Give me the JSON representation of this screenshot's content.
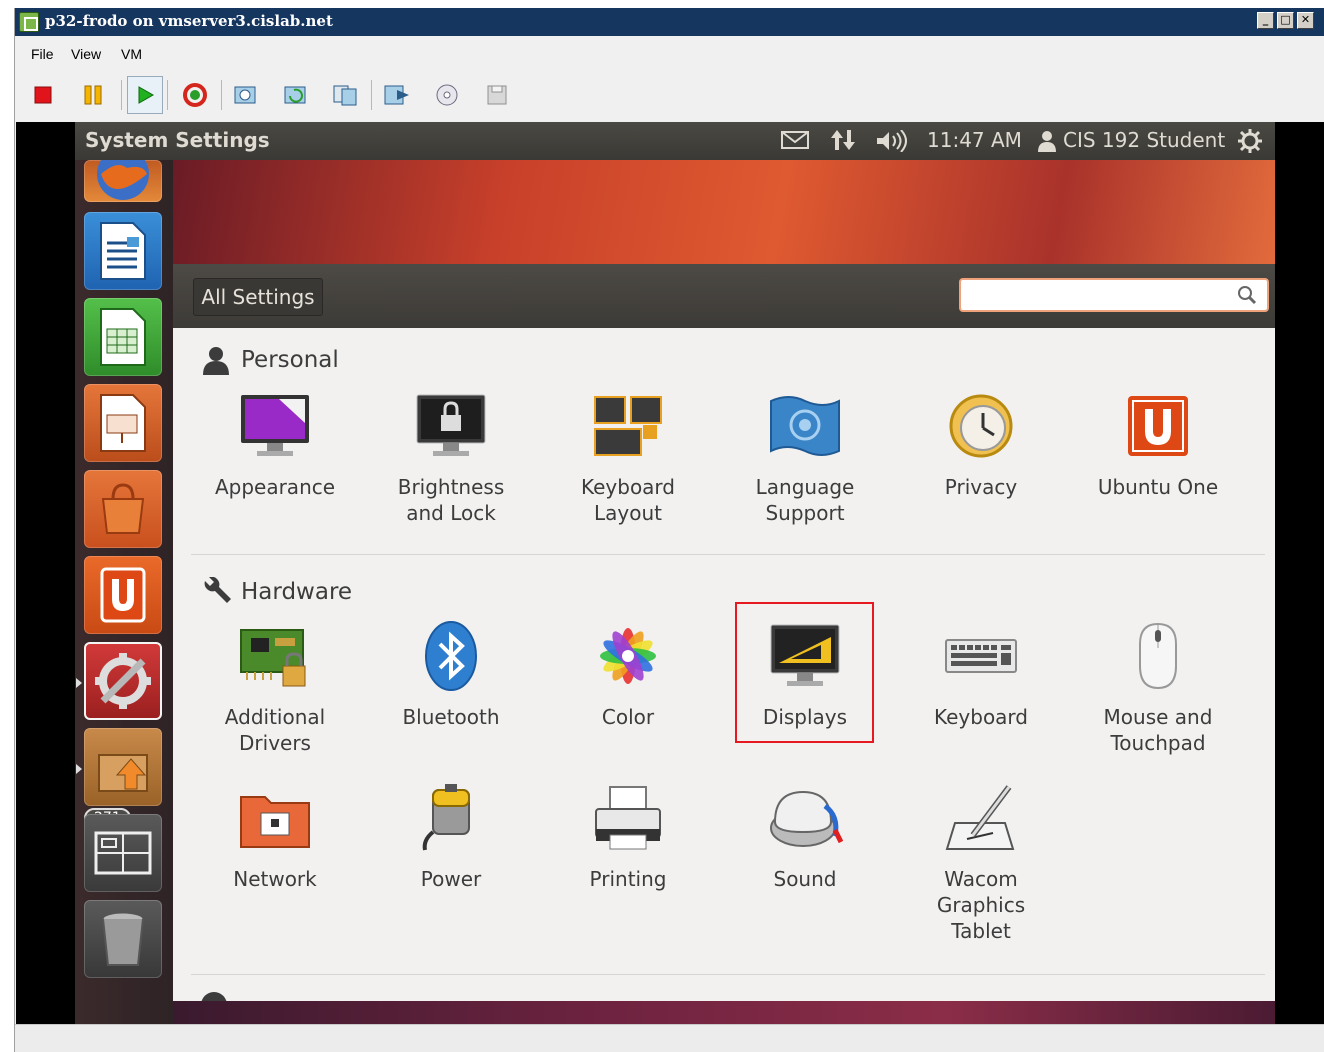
{
  "vm_window": {
    "title": "p32-frodo on vmserver3.cislab.net",
    "controls": {
      "minimize": "_",
      "maximize": "□",
      "close": "✕"
    },
    "menu": [
      "File",
      "View",
      "VM"
    ],
    "toolbar_icons": [
      "stop-icon",
      "pause-icon",
      "play-icon",
      "reset-icon",
      "snapshot-icon",
      "revert-snapshot-icon",
      "manage-snapshots-icon",
      "send-ctrl-alt-del-icon",
      "cd-dvd-icon",
      "floppy-icon"
    ]
  },
  "panel": {
    "app_title": "System Settings",
    "time": "11:47 AM",
    "user": "CIS 192 Student"
  },
  "launcher": {
    "items": [
      "firefox",
      "libreoffice-writer",
      "libreoffice-calc",
      "libreoffice-impress",
      "ubuntu-software-center",
      "ubuntu-one",
      "system-settings",
      "update-manager",
      "workspace-switcher",
      "trash"
    ],
    "badge": "271"
  },
  "toolbar": {
    "all_settings": "All Settings",
    "search_value": ""
  },
  "sections": {
    "personal": {
      "title": "Personal",
      "items": [
        "Appearance",
        "Brightness\nand Lock",
        "Keyboard\nLayout",
        "Language\nSupport",
        "Privacy",
        "Ubuntu One"
      ]
    },
    "hardware": {
      "title": "Hardware",
      "items": [
        "Additional\nDrivers",
        "Bluetooth",
        "Color",
        "Displays",
        "Keyboard",
        "Mouse and\nTouchpad",
        "Network",
        "Power",
        "Printing",
        "Sound",
        "Wacom\nGraphics\nTablet"
      ]
    }
  },
  "colors": {
    "vm_titlebar": "#15365e",
    "ubuntu_panel": "#3c3b37",
    "accent_orange": "#dd4814",
    "highlight": "#e5191f"
  }
}
